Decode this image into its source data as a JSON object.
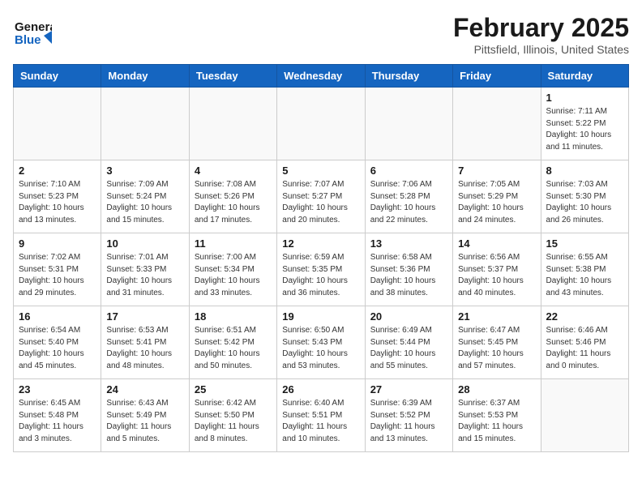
{
  "header": {
    "logo_line1": "General",
    "logo_line2": "Blue",
    "title": "February 2025",
    "subtitle": "Pittsfield, Illinois, United States"
  },
  "days_of_week": [
    "Sunday",
    "Monday",
    "Tuesday",
    "Wednesday",
    "Thursday",
    "Friday",
    "Saturday"
  ],
  "weeks": [
    [
      {
        "day": "",
        "info": ""
      },
      {
        "day": "",
        "info": ""
      },
      {
        "day": "",
        "info": ""
      },
      {
        "day": "",
        "info": ""
      },
      {
        "day": "",
        "info": ""
      },
      {
        "day": "",
        "info": ""
      },
      {
        "day": "1",
        "info": "Sunrise: 7:11 AM\nSunset: 5:22 PM\nDaylight: 10 hours and 11 minutes."
      }
    ],
    [
      {
        "day": "2",
        "info": "Sunrise: 7:10 AM\nSunset: 5:23 PM\nDaylight: 10 hours and 13 minutes."
      },
      {
        "day": "3",
        "info": "Sunrise: 7:09 AM\nSunset: 5:24 PM\nDaylight: 10 hours and 15 minutes."
      },
      {
        "day": "4",
        "info": "Sunrise: 7:08 AM\nSunset: 5:26 PM\nDaylight: 10 hours and 17 minutes."
      },
      {
        "day": "5",
        "info": "Sunrise: 7:07 AM\nSunset: 5:27 PM\nDaylight: 10 hours and 20 minutes."
      },
      {
        "day": "6",
        "info": "Sunrise: 7:06 AM\nSunset: 5:28 PM\nDaylight: 10 hours and 22 minutes."
      },
      {
        "day": "7",
        "info": "Sunrise: 7:05 AM\nSunset: 5:29 PM\nDaylight: 10 hours and 24 minutes."
      },
      {
        "day": "8",
        "info": "Sunrise: 7:03 AM\nSunset: 5:30 PM\nDaylight: 10 hours and 26 minutes."
      }
    ],
    [
      {
        "day": "9",
        "info": "Sunrise: 7:02 AM\nSunset: 5:31 PM\nDaylight: 10 hours and 29 minutes."
      },
      {
        "day": "10",
        "info": "Sunrise: 7:01 AM\nSunset: 5:33 PM\nDaylight: 10 hours and 31 minutes."
      },
      {
        "day": "11",
        "info": "Sunrise: 7:00 AM\nSunset: 5:34 PM\nDaylight: 10 hours and 33 minutes."
      },
      {
        "day": "12",
        "info": "Sunrise: 6:59 AM\nSunset: 5:35 PM\nDaylight: 10 hours and 36 minutes."
      },
      {
        "day": "13",
        "info": "Sunrise: 6:58 AM\nSunset: 5:36 PM\nDaylight: 10 hours and 38 minutes."
      },
      {
        "day": "14",
        "info": "Sunrise: 6:56 AM\nSunset: 5:37 PM\nDaylight: 10 hours and 40 minutes."
      },
      {
        "day": "15",
        "info": "Sunrise: 6:55 AM\nSunset: 5:38 PM\nDaylight: 10 hours and 43 minutes."
      }
    ],
    [
      {
        "day": "16",
        "info": "Sunrise: 6:54 AM\nSunset: 5:40 PM\nDaylight: 10 hours and 45 minutes."
      },
      {
        "day": "17",
        "info": "Sunrise: 6:53 AM\nSunset: 5:41 PM\nDaylight: 10 hours and 48 minutes."
      },
      {
        "day": "18",
        "info": "Sunrise: 6:51 AM\nSunset: 5:42 PM\nDaylight: 10 hours and 50 minutes."
      },
      {
        "day": "19",
        "info": "Sunrise: 6:50 AM\nSunset: 5:43 PM\nDaylight: 10 hours and 53 minutes."
      },
      {
        "day": "20",
        "info": "Sunrise: 6:49 AM\nSunset: 5:44 PM\nDaylight: 10 hours and 55 minutes."
      },
      {
        "day": "21",
        "info": "Sunrise: 6:47 AM\nSunset: 5:45 PM\nDaylight: 10 hours and 57 minutes."
      },
      {
        "day": "22",
        "info": "Sunrise: 6:46 AM\nSunset: 5:46 PM\nDaylight: 11 hours and 0 minutes."
      }
    ],
    [
      {
        "day": "23",
        "info": "Sunrise: 6:45 AM\nSunset: 5:48 PM\nDaylight: 11 hours and 3 minutes."
      },
      {
        "day": "24",
        "info": "Sunrise: 6:43 AM\nSunset: 5:49 PM\nDaylight: 11 hours and 5 minutes."
      },
      {
        "day": "25",
        "info": "Sunrise: 6:42 AM\nSunset: 5:50 PM\nDaylight: 11 hours and 8 minutes."
      },
      {
        "day": "26",
        "info": "Sunrise: 6:40 AM\nSunset: 5:51 PM\nDaylight: 11 hours and 10 minutes."
      },
      {
        "day": "27",
        "info": "Sunrise: 6:39 AM\nSunset: 5:52 PM\nDaylight: 11 hours and 13 minutes."
      },
      {
        "day": "28",
        "info": "Sunrise: 6:37 AM\nSunset: 5:53 PM\nDaylight: 11 hours and 15 minutes."
      },
      {
        "day": "",
        "info": ""
      }
    ]
  ]
}
